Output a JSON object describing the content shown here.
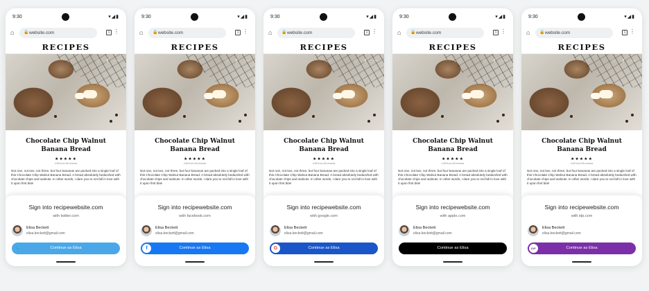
{
  "status": {
    "time": "9:30",
    "icons": "▾◢▮"
  },
  "browser": {
    "url": "website.com",
    "tab_count": "1"
  },
  "page": {
    "site_title": "RECIPES",
    "recipe_title": "Chocolate Chip Walnut Banana Bread",
    "rating_stars": "★★★★★",
    "reviews": "4.89 from 48 reviews",
    "blurb": "Not one, not two, not three, but four bananas are packed into a single loaf of this Chocolate Chip Walnut Banana Bread. A bread absolutely bedazzled with chocolate chips and walnuts. In other words, I dare you to not fall in love with it upon first bite!"
  },
  "account": {
    "name": "Elisa Beckett",
    "email": "elisa.beckett@gmail.com"
  },
  "sheet": {
    "title": "Sign into recipewebsite.com",
    "cta_label": "Continue as Elisa"
  },
  "providers": [
    {
      "key": "twitter",
      "subtitle": "with twitter.com",
      "color": "#4aa8e8",
      "icon": "twitter-icon",
      "glyph": "🐦",
      "icon_bg": "transparent",
      "icon_fg": "#ffffff"
    },
    {
      "key": "facebook",
      "subtitle": "with facebook.com",
      "color": "#1877f2",
      "icon": "facebook-icon",
      "glyph": "f",
      "icon_bg": "#ffffff",
      "icon_fg": "#1877f2"
    },
    {
      "key": "google",
      "subtitle": "with google.com",
      "color": "#1a56c8",
      "icon": "google-icon",
      "glyph": "G",
      "icon_bg": "#ffffff",
      "icon_fg": "#ea4335"
    },
    {
      "key": "apple",
      "subtitle": "with apple.com",
      "color": "#000000",
      "icon": "apple-icon",
      "glyph": "",
      "icon_bg": "transparent",
      "icon_fg": "#ffffff"
    },
    {
      "key": "idp",
      "subtitle": "with idp.com",
      "color": "#7b2fa8",
      "icon": "idp-icon",
      "glyph": "IDP",
      "icon_bg": "#ffffff",
      "icon_fg": "#7b2fa8"
    }
  ]
}
